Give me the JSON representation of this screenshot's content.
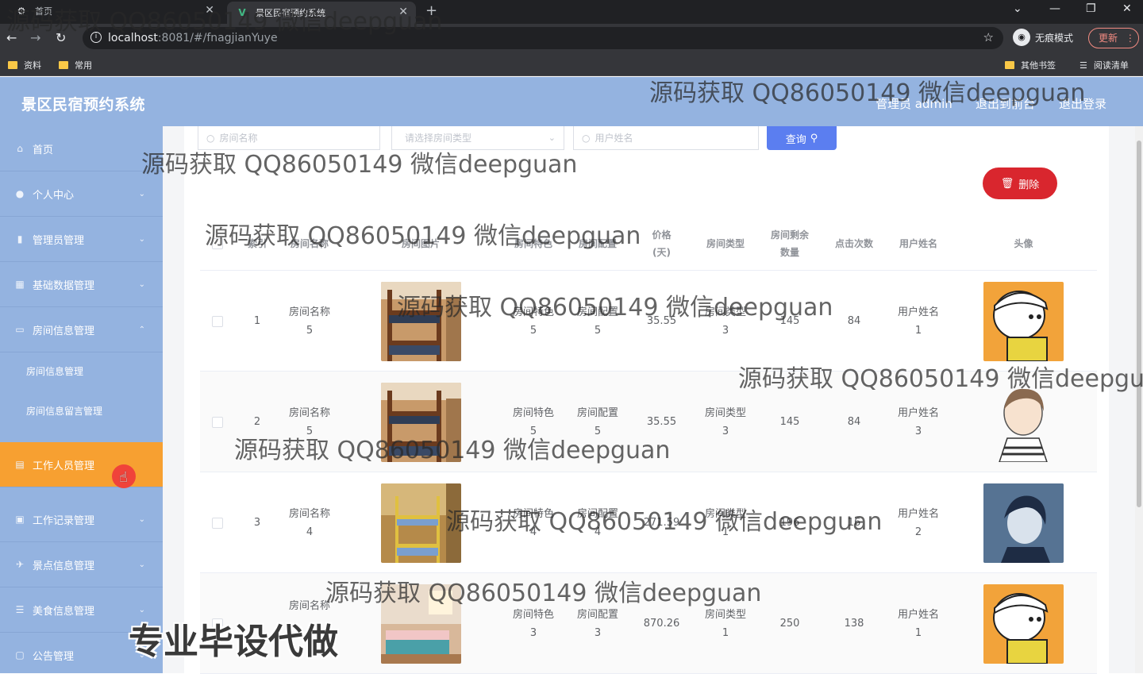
{
  "browser": {
    "tabs": [
      {
        "title": "首页"
      },
      {
        "title": "景区民宿预约系统"
      }
    ],
    "url_host": "localhost",
    "url_rest": ":8081/#/fnagjianYuye",
    "incognito_label": "无痕模式",
    "update_label": "更新",
    "bookmarks": [
      "资料",
      "常用"
    ],
    "bookmarks_right": [
      "其他书签",
      "阅读清单"
    ]
  },
  "header": {
    "title": "景区民宿预约系统",
    "admin_label": "管理员 admin",
    "back_label": "退出到前台",
    "logout_label": "退出登录"
  },
  "sidebar": {
    "items": [
      {
        "label": "首页",
        "icon": "home-icon"
      },
      {
        "label": "个人中心",
        "icon": "user-icon"
      },
      {
        "label": "管理员管理",
        "icon": "chart-icon"
      },
      {
        "label": "基础数据管理",
        "icon": "grid-icon"
      },
      {
        "label": "房间信息管理",
        "icon": "room-icon"
      },
      {
        "label": "工作人员管理",
        "icon": "staff-icon"
      },
      {
        "label": "工作记录管理",
        "icon": "record-icon"
      },
      {
        "label": "景点信息管理",
        "icon": "scenic-icon"
      },
      {
        "label": "美食信息管理",
        "icon": "food-icon"
      },
      {
        "label": "公告管理",
        "icon": "notice-icon"
      }
    ],
    "submenu": [
      "房间信息管理",
      "房间信息留言管理"
    ]
  },
  "search": {
    "room_name_placeholder": "房间名称",
    "room_type_placeholder": "请选择房间类型",
    "user_name_placeholder": "用户姓名",
    "query_label": "查询",
    "delete_label": "删除"
  },
  "table": {
    "headers": {
      "index": "索引",
      "room_name": "房间名称",
      "room_image": "房间图片",
      "feature": "房间特色",
      "config": "房间配置",
      "price": "价格(天)",
      "room_type": "房间类型",
      "remaining": "房间剩余数量",
      "clicks": "点击次数",
      "user_name": "用户姓名",
      "avatar": "头像"
    },
    "rows": [
      {
        "index": "1",
        "room_name": "房间名称5",
        "feature": "房间特色5",
        "config": "房间配置5",
        "price": "35.55",
        "room_type": "房间类型3",
        "remaining": "145",
        "clicks": "84",
        "user_name": "用户姓名1"
      },
      {
        "index": "2",
        "room_name": "房间名称5",
        "feature": "房间特色5",
        "config": "房间配置5",
        "price": "35.55",
        "room_type": "房间类型3",
        "remaining": "145",
        "clicks": "84",
        "user_name": "用户姓名3"
      },
      {
        "index": "3",
        "room_name": "房间名称4",
        "feature": "房间特色4",
        "config": "房间配置4",
        "price": "271.59",
        "room_type": "房间类型1",
        "remaining": "196",
        "clicks": "16",
        "user_name": "用户姓名2"
      },
      {
        "index": "",
        "room_name": "房间名称",
        "feature": "房间特色3",
        "config": "房间配置3",
        "price": "870.26",
        "room_type": "房间类型1",
        "remaining": "250",
        "clicks": "138",
        "user_name": "用户姓名1"
      }
    ]
  },
  "overlay": {
    "watermark": "源码获取 QQ86050149 微信deepguan",
    "watermark_cut": "源码获取 QQ86050149 微信deepgua",
    "promo": "专业毕设代做"
  },
  "colors": {
    "sidebar_bg": "#94b3e0",
    "active_item": "#f7a031",
    "query_button": "#5b7ef0",
    "delete_button": "#d9262e"
  }
}
